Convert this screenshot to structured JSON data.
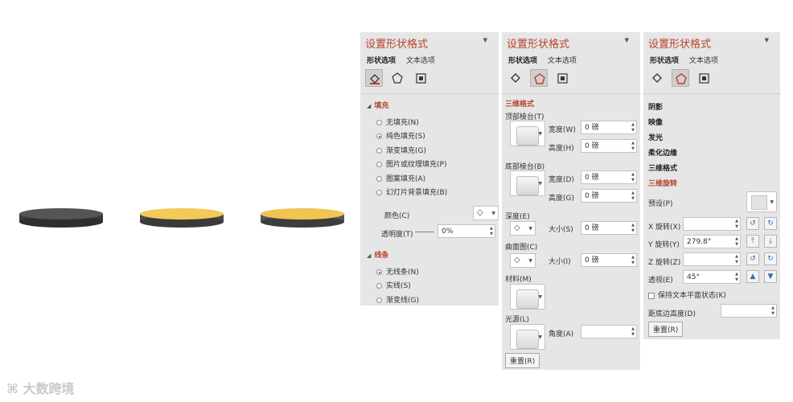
{
  "colors": {
    "panel_bg": "#e6e6e6",
    "accent_red": "#b5432a",
    "disc_dark": "#4a4a4a",
    "disc_gold": "#f3c95a"
  },
  "panel1": {
    "title": "设置形状格式",
    "tabs": [
      "形状选项",
      "文本选项"
    ],
    "icons": [
      "fill-line-icon",
      "effects-pentagon-icon",
      "size-properties-icon"
    ],
    "fill_section": "填充",
    "fill_options": [
      "无填充(N)",
      "纯色填充(S)",
      "渐变填充(G)",
      "图片或纹理填充(P)",
      "图案填充(A)",
      "幻灯片背景填充(B)"
    ],
    "selected_fill": 1,
    "color_label": "颜色(C)",
    "transparency_label": "透明度(T)",
    "transparency_value": "0%",
    "line_section": "线条",
    "line_options": [
      "无线条(N)",
      "实线(S)",
      "渐变线(G)"
    ],
    "selected_line": 0
  },
  "panel2": {
    "title": "设置形状格式",
    "tabs": [
      "形状选项",
      "文本选项"
    ],
    "section": "三维格式",
    "top_bevel": "顶部棱台(T)",
    "width_label_1": "宽度(W)",
    "width_value_1": "0 磅",
    "height_label_1": "高度(H)",
    "height_value_1": "0 磅",
    "bottom_bevel": "底部棱台(B)",
    "width_label_2": "宽度(D)",
    "width_value_2": "0 磅",
    "height_label_2": "高度(G)",
    "height_value_2": "0 磅",
    "depth": "深度(E)",
    "depth_size_label": "大小(S)",
    "depth_size_value": "0 磅",
    "contour": "曲面图(C)",
    "contour_size_label": "大小(I)",
    "contour_size_value": "0 磅",
    "material": "材料(M)",
    "lighting": "光源(L)",
    "angle_label": "角度(A)",
    "angle_value": "",
    "reset": "重置(R)"
  },
  "panel3": {
    "title": "设置形状格式",
    "tabs": [
      "形状选项",
      "文本选项"
    ],
    "categories": [
      "阴影",
      "映像",
      "发光",
      "柔化边缘",
      "三维格式"
    ],
    "active_category": "三维旋转",
    "preset_label": "预设(P)",
    "x_label": "X 旋转(X)",
    "x_value": "",
    "y_label": "Y 旋转(Y)",
    "y_value": "279.8°",
    "z_label": "Z 旋转(Z)",
    "z_value": "",
    "perspective_label": "透视(E)",
    "perspective_value": "45°",
    "keep_text_flat": "保持文本平面状态(K)",
    "distance_label": "距底边高度(D)",
    "distance_value": "",
    "reset": "重置(R)"
  },
  "watermark": "大数跨境"
}
